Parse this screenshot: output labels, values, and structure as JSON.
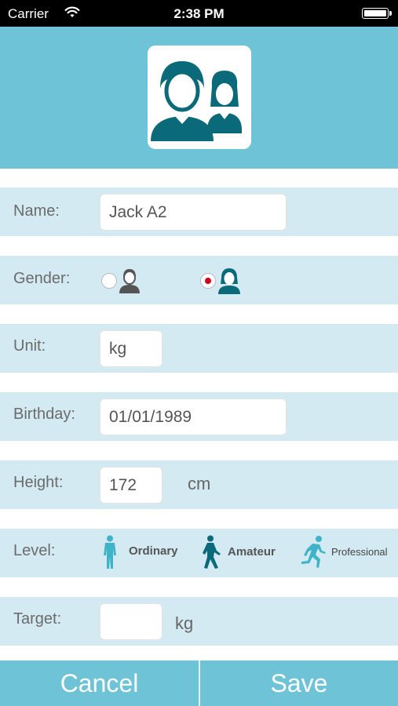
{
  "status_bar": {
    "carrier": "Carrier",
    "time": "2:38 PM"
  },
  "colors": {
    "accent": "#6ec3d6",
    "row_bg": "#d3eaf3",
    "icon_dark": "#0b6a7a",
    "icon_light": "#3fb3c8",
    "radio_selected": "#d0021b"
  },
  "form": {
    "name": {
      "label": "Name:",
      "value": "Jack A2"
    },
    "gender": {
      "label": "Gender:",
      "selected": "female"
    },
    "unit": {
      "label": "Unit:",
      "value": "kg"
    },
    "birthday": {
      "label": "Birthday:",
      "value": "01/01/1989"
    },
    "height": {
      "label": "Height:",
      "value": "172",
      "unit": "cm"
    },
    "level": {
      "label": "Level:",
      "options": [
        {
          "label": "Ordinary",
          "icon": "standing-person-icon"
        },
        {
          "label": "Amateur",
          "icon": "walking-person-icon"
        },
        {
          "label": "Professional",
          "icon": "running-person-icon"
        }
      ]
    },
    "target": {
      "label": "Target:",
      "value": "",
      "unit": "kg"
    }
  },
  "footer": {
    "cancel": "Cancel",
    "save": "Save"
  }
}
